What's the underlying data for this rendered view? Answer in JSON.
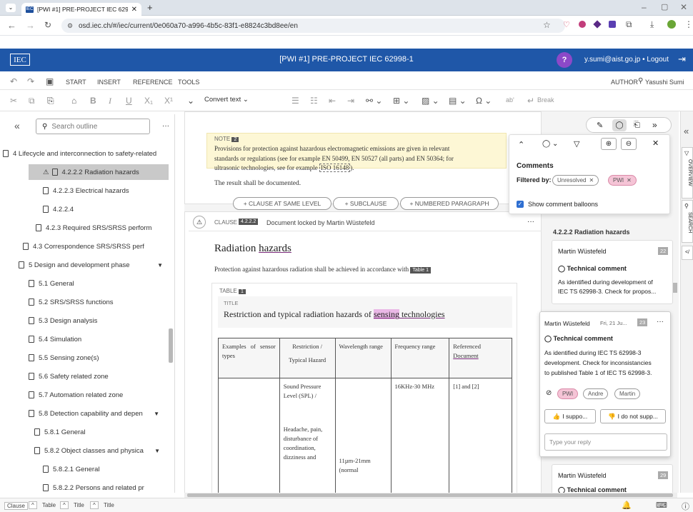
{
  "browser": {
    "tab_title": "[PWI #1] PRE-PROJECT IEC 629",
    "tab_favicon_text": "IEC",
    "url": "osd.iec.ch/#/iec/current/0e060a70-a996-4b5c-83f1-e8824c3bd8ee/en"
  },
  "header": {
    "logo": "IEC",
    "title": "[PWI #1] PRE-PROJECT IEC 62998-1",
    "user": "y.sumi@aist.go.jp • Logout",
    "help": "?"
  },
  "ribbon": {
    "tabs": [
      "START",
      "INSERT",
      "REFERENCE",
      "TOOLS"
    ],
    "role": "AUTHOR",
    "user_short": "Yasushi Sumi"
  },
  "toolbar": {
    "convert_text": "Convert text",
    "break": "Break",
    "abl": "ab'"
  },
  "outline": {
    "search_placeholder": "Search outline",
    "more": "···",
    "items": [
      "4 Lifecycle and interconnection to safety-related",
      "4.2.2.2 Radiation hazards",
      "4.2.2.3 Electrical hazards",
      "4.2.2.4",
      "4.2.3 Required SRS/SRSS perform",
      "4.3 Correspondence SRS/SRSS perf",
      "5 Design and development phase",
      "5.1 General",
      "5.2 SRS/SRSS functions",
      "5.3 Design analysis",
      "5.4 Simulation",
      "5.5 Sensing zone(s)",
      "5.6 Safety related zone",
      "5.7 Automation related zone",
      "5.8 Detection capability and depen",
      "5.8.1 General",
      "5.8.2 Object classes and physica",
      "5.8.2.1 General",
      "5.8.2.2 Persons and related pr"
    ]
  },
  "note": {
    "label": "NOTE",
    "number": "2",
    "text_1": "Provisions for protection against hazardous electromagnetic emissions are given in relevant",
    "text_2": "standards or regulations (see for example EN 50499, EN 50527 (all parts) and EN 50364; for",
    "text_3a": "ultrasonic technologies, see for example ",
    "text_3b": "ISO 16148",
    "text_3c": ")."
  },
  "doc": {
    "documented": "The result shall be documented.",
    "add_clause": "+ CLAUSE AT SAME LEVEL",
    "add_subclause": "+ SUBCLAUSE",
    "add_paragraph": "+ NUMBERED PARAGRAPH",
    "clause_label": "CLAUSE",
    "clause_number": "4.2.2.2",
    "locked": "Document locked by Martin Wüstefeld",
    "heading_a": "Radiation ",
    "heading_b": "hazards",
    "para": "Protection against hazardous radiation shall be achieved in accordance with",
    "table_ref": "Table 1",
    "table_label": "TABLE",
    "table_number": "1",
    "title_label": "TITLE",
    "title_a": "Restriction and typical radiation hazards of ",
    "title_b": "sensing",
    "title_c": " technologies",
    "col_1": "Examples of sensor types",
    "col_2a": "Restriction /",
    "col_2b": "Typical Hazard",
    "col_3": "Wavelength range",
    "col_4": "Frequency range",
    "col_5a": "Referenced",
    "col_5b": "Document",
    "cell_r1c2a": "Sound Pressure Level (SPL) /",
    "cell_r1c2b": "Headache, pain, disturbance of coordination, dizziness and",
    "cell_r1c3": "11µm-21mm (normal",
    "cell_r1c4": "16KHz-30 MHz",
    "cell_r1c5": "[1] and [2]"
  },
  "comments_popup": {
    "title": "Comments",
    "filtered_by": "Filtered by:",
    "filter_1": "Unresolved",
    "filter_2": "PWI",
    "show_balloons": "Show comment balloons"
  },
  "comments": {
    "section": "4.2.2.2 Radiation hazards",
    "c1_author": "Martin Wüstefeld",
    "c1_num": "22",
    "c1_type": "Technical comment",
    "c1_text_1": "As identified during development of",
    "c1_text_2": "IEC TS 62998-3.  Check for propos...",
    "c2_author": "Martin Wüstefeld",
    "c2_date": "Fri, 21 Ju...",
    "c2_num": "23",
    "c2_type": "Technical comment",
    "c2_text_1": "As identified during IEC TS 62998-3",
    "c2_text_2": "development. Check for inconsistancies",
    "c2_text_3": "to published Table 1 of IEC TS 62998-3.",
    "tags": [
      "PWI",
      "Andre",
      "Martin"
    ],
    "support": "I suppo...",
    "not_support": "I do not supp...",
    "reply_placeholder": "Type your reply",
    "c3_author": "Martin Wüstefeld",
    "c3_num": "29",
    "c3_type": "Technical comment"
  },
  "right_rail": [
    "OVERVIEW",
    "SEARCH"
  ],
  "status_bar": [
    "Clause",
    "Table",
    "Title",
    "Title"
  ],
  "colors": {
    "header_bg": "#1f57a8",
    "note_bg": "#fdf7d5",
    "highlight": "#eab8e6",
    "pwi_tag": "#f5c4d6",
    "selected_outline": "#c9c9c9"
  }
}
